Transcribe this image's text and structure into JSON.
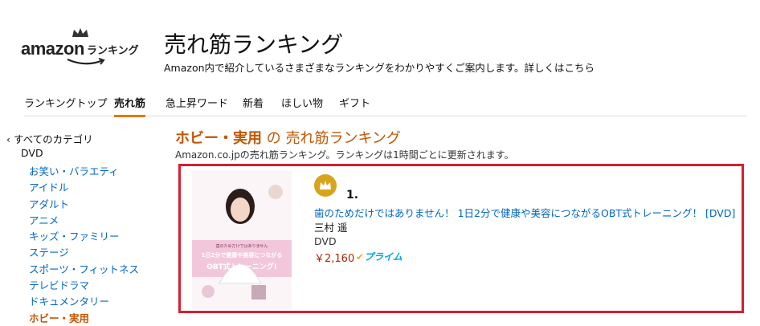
{
  "header": {
    "logo_amazon": "amazon",
    "logo_suffix": "ランキング",
    "title": "売れ筋ランキング",
    "subtitle": "Amazon内で紹介しているさまざまなランキングをわかりやすくご案内します。詳しくはこちら"
  },
  "tabs": [
    {
      "label": "ランキングトップ"
    },
    {
      "label": "売れ筋"
    },
    {
      "label": "急上昇ワード"
    },
    {
      "label": "新着"
    },
    {
      "label": "ほしい物"
    },
    {
      "label": "ギフト"
    }
  ],
  "sidebar": {
    "all": "‹ すべてのカテゴリ",
    "parent": "DVD",
    "items": [
      {
        "label": "お笑い・バラエティ"
      },
      {
        "label": "アイドル"
      },
      {
        "label": "アダルト"
      },
      {
        "label": "アニメ"
      },
      {
        "label": "キッズ・ファミリー"
      },
      {
        "label": "ステージ"
      },
      {
        "label": "スポーツ・フィットネス"
      },
      {
        "label": "テレビドラマ"
      },
      {
        "label": "ドキュメンタリー"
      },
      {
        "label": "ホビー・実用"
      }
    ]
  },
  "main": {
    "heading_category": "ホビー・実用",
    "heading_suffix": " の 売れ筋ランキング",
    "description": "Amazon.co.jpの売れ筋ランキング。ランキングは1時間ごとに更新されます。",
    "item": {
      "rank": "1.",
      "title": "歯のためだけではありません！ 1日2分で健康や美容につながるOBT式トレーニング！ [DVD]",
      "author": "三村 遥",
      "format": "DVD",
      "price": "￥2,160",
      "prime": "プライム",
      "cover": {
        "top_text": "歯のためだけではありません",
        "main_text": "1日2分で健康や美容につながる",
        "big_text": "OBT式トレーニング!"
      }
    }
  },
  "colors": {
    "accent": "#e47911",
    "link": "#0066c0",
    "category": "#c45500",
    "price": "#b12704",
    "highlight_box": "#d32030",
    "badge": "#d9a41a"
  }
}
